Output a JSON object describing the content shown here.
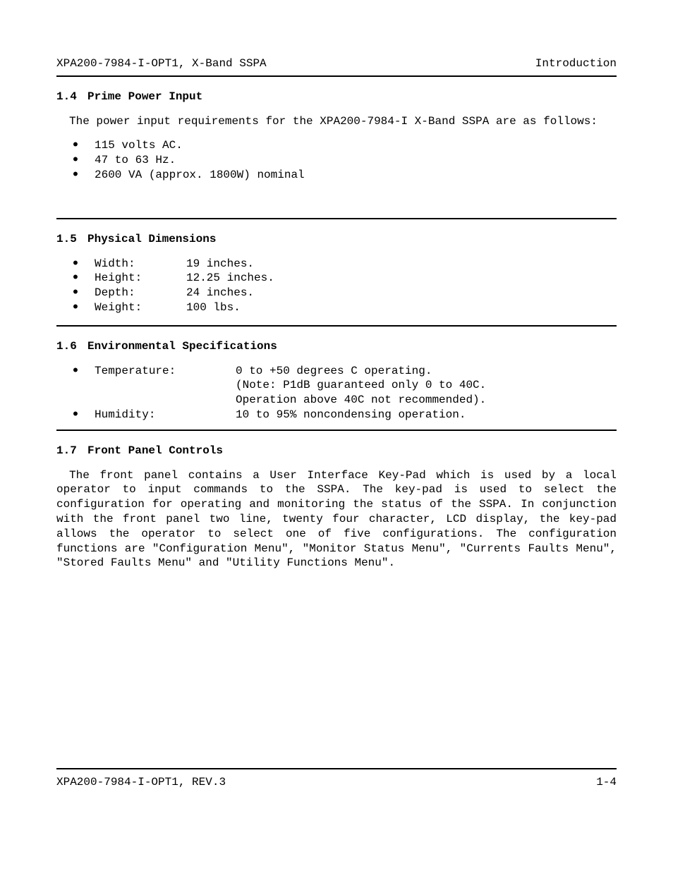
{
  "header": {
    "left": "XPA200-7984-I-OPT1, X-Band SSPA",
    "right": "Introduction"
  },
  "sections": {
    "s14": {
      "num": "1.4",
      "title": "Prime Power Input",
      "intro": "The power input requirements for the XPA200-7984-I X-Band SSPA are as follows:",
      "bullets": [
        "115 volts AC.",
        "47 to 63 Hz.",
        "2600 VA (approx. 1800W) nominal"
      ]
    },
    "s15": {
      "num": "1.5",
      "title": "Physical Dimensions",
      "bullets": [
        {
          "label": "Width:",
          "value": "19 inches."
        },
        {
          "label": "Height:",
          "value": "12.25 inches."
        },
        {
          "label": "Depth:",
          "value": "24 inches."
        },
        {
          "label": "Weight:",
          "value": "100 lbs."
        }
      ]
    },
    "s16": {
      "num": "1.6",
      "title": "Environmental Specifications",
      "bullets": [
        {
          "label": "Temperature:",
          "value": "0 to +50 degrees C operating.\n(Note: P1dB guaranteed only 0 to 40C.\nOperation above 40C not recommended)."
        },
        {
          "label": "Humidity:",
          "value": "10 to 95% noncondensing operation."
        }
      ]
    },
    "s17": {
      "num": "1.7",
      "title": "Front Panel Controls",
      "para": "The front panel contains a User Interface Key-Pad which is  used by a local operator to input commands to the SSPA.  The key-pad is used to select the configuration for operating and monitoring the status of the SSPA.  In conjunction with the front panel two line, twenty four character, LCD display, the key-pad allows the operator to select one of five configurations.  The configuration functions are \"Configuration Menu\", \"Monitor Status Menu\", \"Currents Faults Menu\", \"Stored Faults Menu\" and \"Utility Functions Menu\"."
    }
  },
  "footer": {
    "left": "XPA200-7984-I-OPT1, REV.3",
    "right": "1-4"
  }
}
